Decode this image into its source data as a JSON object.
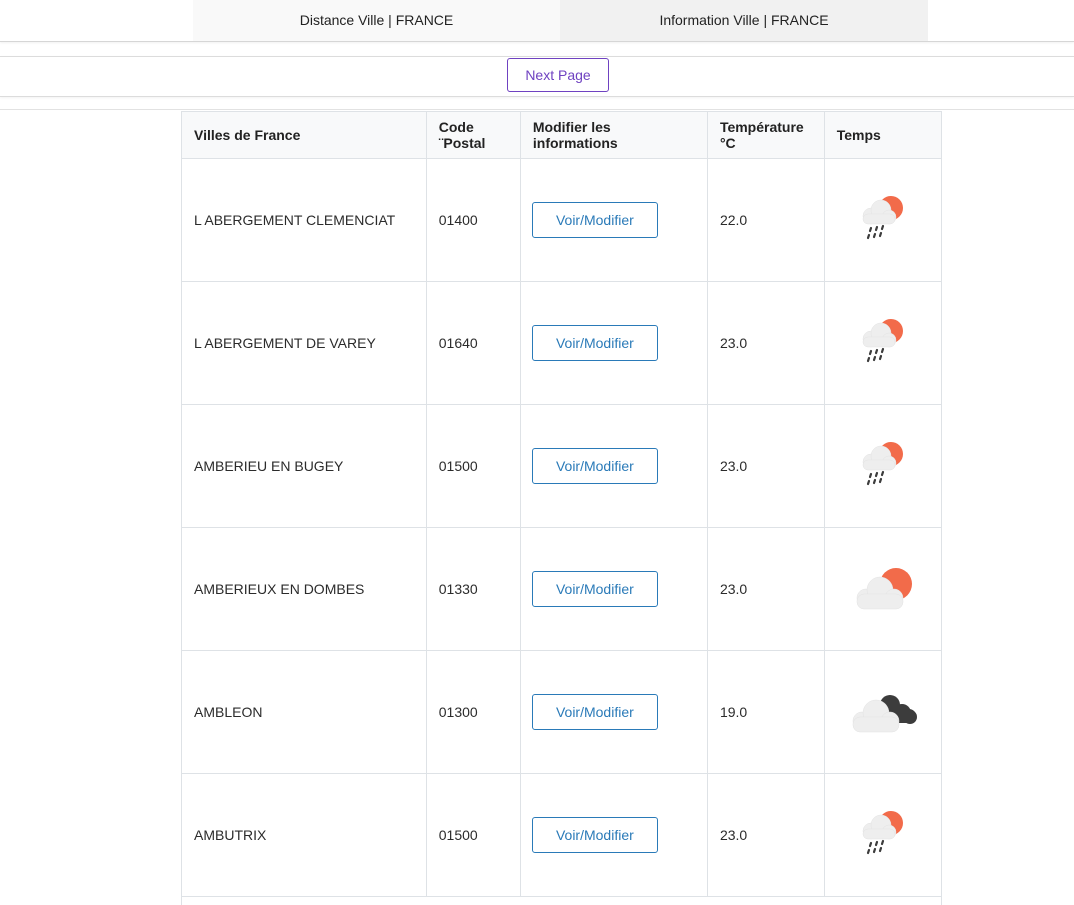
{
  "nav": {
    "tabs": [
      {
        "label": "Distance Ville | FRANCE"
      },
      {
        "label": "Information Ville | FRANCE"
      }
    ]
  },
  "pager": {
    "next_label": "Next Page"
  },
  "table": {
    "headers": {
      "city": "Villes de France",
      "postal": "Code ¨Postal",
      "modify": "Modifier les informations",
      "temperature": "Température °C",
      "weather": "Temps"
    },
    "rows": [
      {
        "city": "L ABERGEMENT CLEMENCIAT",
        "postal": "01400",
        "button": "Voir/Modifier",
        "temperature": "22.0",
        "weather_icon": "rain-sun-icon"
      },
      {
        "city": "L ABERGEMENT DE VAREY",
        "postal": "01640",
        "button": "Voir/Modifier",
        "temperature": "23.0",
        "weather_icon": "rain-sun-icon"
      },
      {
        "city": "AMBERIEU EN BUGEY",
        "postal": "01500",
        "button": "Voir/Modifier",
        "temperature": "23.0",
        "weather_icon": "rain-sun-icon"
      },
      {
        "city": "AMBERIEUX EN DOMBES",
        "postal": "01330",
        "button": "Voir/Modifier",
        "temperature": "23.0",
        "weather_icon": "partly-cloudy-icon"
      },
      {
        "city": "AMBLEON",
        "postal": "01300",
        "button": "Voir/Modifier",
        "temperature": "19.0",
        "weather_icon": "cloudy-icon"
      },
      {
        "city": "AMBUTRIX",
        "postal": "01500",
        "button": "Voir/Modifier",
        "temperature": "23.0",
        "weather_icon": "rain-sun-icon"
      }
    ]
  },
  "colors": {
    "accent_purple": "#6f42c1",
    "button_blue": "#2a7ab8",
    "sun_orange": "#f26b4a",
    "cloud_light": "#eeeeee",
    "cloud_dark": "#3c3c3c"
  }
}
